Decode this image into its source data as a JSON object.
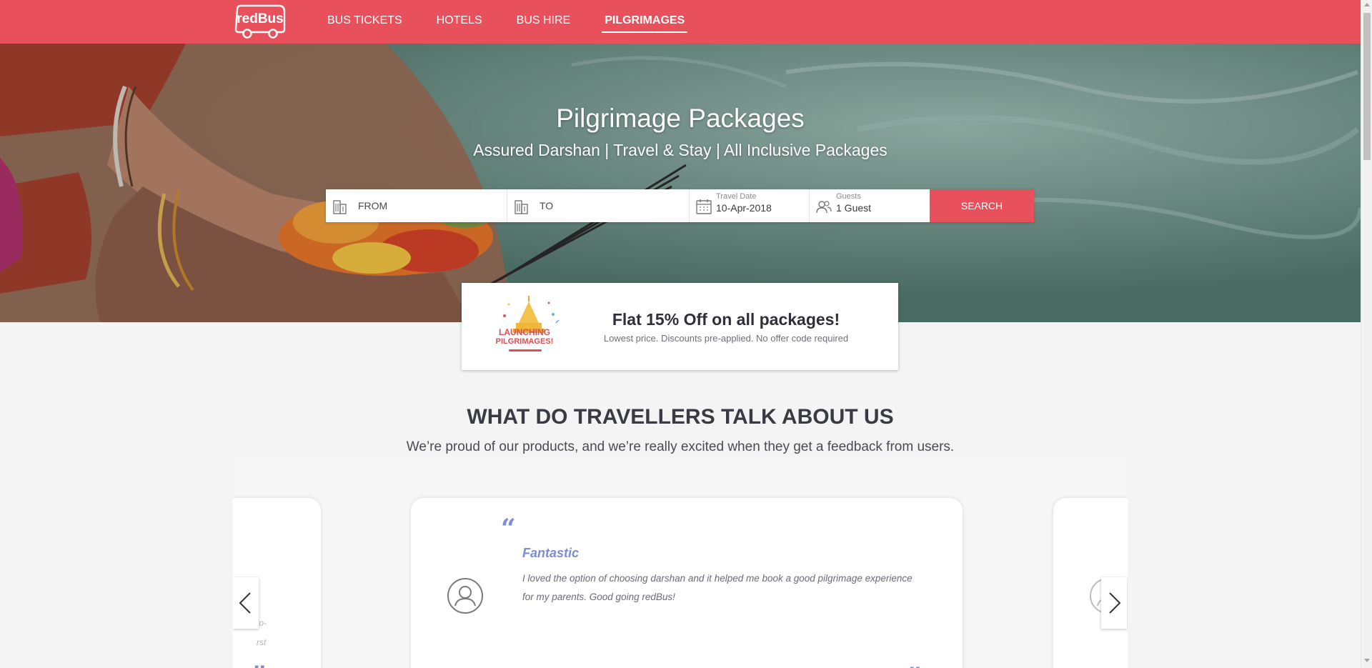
{
  "brand": {
    "logo_text": "redBus",
    "color": "#e8505b"
  },
  "nav": {
    "items": [
      {
        "label": "BUS TICKETS"
      },
      {
        "label": "HOTELS"
      },
      {
        "label": "BUS HIRE"
      },
      {
        "label": "PILGRIMAGES",
        "active": true
      }
    ]
  },
  "hero": {
    "title": "Pilgrimage Packages",
    "subtitle": "Assured Darshan | Travel & Stay | All Inclusive Packages"
  },
  "search": {
    "from_placeholder": "FROM",
    "to_placeholder": "TO",
    "date_label": "Travel Date",
    "date_value": "10-Apr-2018",
    "guests_label": "Guests",
    "guests_value": "1 Guest",
    "button_label": "SEARCH",
    "icons": {
      "from": "building-icon",
      "to": "building-icon",
      "date": "calendar-icon",
      "guests": "users-icon"
    }
  },
  "offer": {
    "badge_line1": "LAUNCHING",
    "badge_line2": "PILGRIMAGES!",
    "title": "Flat 15% Off on all packages!",
    "subtitle": "Lowest price. Discounts pre-applied. No offer code required"
  },
  "testimonials": {
    "title": "WHAT DO TRAVELLERS TALK ABOUT US",
    "subtitle": "We’re proud of our products, and we’re really excited when they get a feedback from users.",
    "active": {
      "name": "Fantastic",
      "text": "I loved the option of choosing darshan and it helped me book a good pilgrimage experience for my parents. Good going redBus!"
    },
    "left_fragment_line1": "to-",
    "left_fragment_line2": "rst",
    "quote_open": "“",
    "quote_close": "”",
    "prev_icon": "chevron-left-icon",
    "next_icon": "chevron-right-icon",
    "quote_color": "#7b8ed1"
  }
}
